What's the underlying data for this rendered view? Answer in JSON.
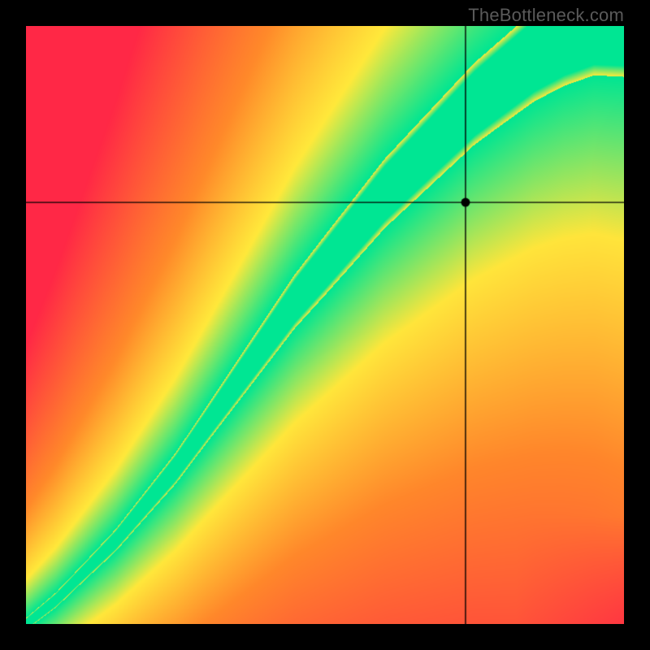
{
  "watermark": "TheBottleneck.com",
  "chart_data": {
    "type": "heatmap",
    "title": "",
    "xlabel": "",
    "ylabel": "",
    "xlim": [
      0,
      1
    ],
    "ylim": [
      0,
      1
    ],
    "notes": "Continuous red→yellow→green bottleneck surface; green band is the optimal diagonal ridge. Crosshair marks the queried configuration.",
    "crosshair": {
      "x": 0.735,
      "y": 0.705
    },
    "ridge": [
      {
        "x": 0.0,
        "y": 0.0
      },
      {
        "x": 0.05,
        "y": 0.04
      },
      {
        "x": 0.1,
        "y": 0.09
      },
      {
        "x": 0.15,
        "y": 0.14
      },
      {
        "x": 0.2,
        "y": 0.2
      },
      {
        "x": 0.25,
        "y": 0.26
      },
      {
        "x": 0.3,
        "y": 0.33
      },
      {
        "x": 0.35,
        "y": 0.4
      },
      {
        "x": 0.4,
        "y": 0.47
      },
      {
        "x": 0.45,
        "y": 0.54
      },
      {
        "x": 0.5,
        "y": 0.6
      },
      {
        "x": 0.55,
        "y": 0.66
      },
      {
        "x": 0.6,
        "y": 0.72
      },
      {
        "x": 0.65,
        "y": 0.77
      },
      {
        "x": 0.7,
        "y": 0.82
      },
      {
        "x": 0.75,
        "y": 0.87
      },
      {
        "x": 0.8,
        "y": 0.91
      },
      {
        "x": 0.85,
        "y": 0.95
      },
      {
        "x": 0.9,
        "y": 0.98
      },
      {
        "x": 0.95,
        "y": 1.0
      }
    ],
    "ridge_width": [
      {
        "x": 0.0,
        "w": 0.01
      },
      {
        "x": 0.1,
        "w": 0.015
      },
      {
        "x": 0.2,
        "w": 0.022
      },
      {
        "x": 0.3,
        "w": 0.03
      },
      {
        "x": 0.4,
        "w": 0.04
      },
      {
        "x": 0.5,
        "w": 0.05
      },
      {
        "x": 0.6,
        "w": 0.058
      },
      {
        "x": 0.7,
        "w": 0.065
      },
      {
        "x": 0.8,
        "w": 0.072
      },
      {
        "x": 0.9,
        "w": 0.08
      },
      {
        "x": 1.0,
        "w": 0.085
      }
    ],
    "palette": {
      "green": "#00e693",
      "yellow": "#ffe93b",
      "orange": "#ff8a2a",
      "red": "#ff2846"
    }
  }
}
